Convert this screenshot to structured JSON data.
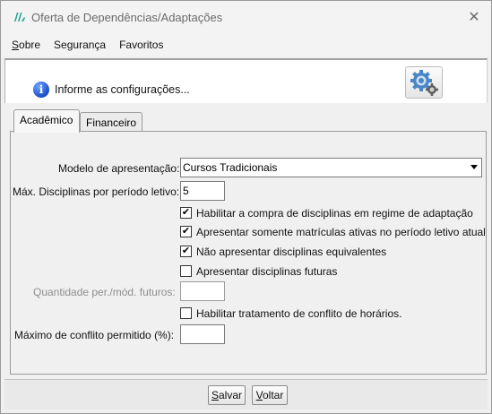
{
  "window": {
    "title": "Oferta de Dependências/Adaptações",
    "close_glyph": "✕"
  },
  "menu": [
    {
      "label": "Sobre",
      "accel": "S",
      "rest": "obre"
    },
    {
      "label": "Segurança"
    },
    {
      "label": "Favoritos"
    }
  ],
  "header": {
    "info_glyph": "i",
    "message": "Informe as configurações...",
    "config_icon": "gear-icon"
  },
  "tabs": [
    {
      "label": "Acadêmico",
      "selected": true
    },
    {
      "label": "Financeiro",
      "selected": false
    }
  ],
  "form": {
    "modelo_label": "Modelo de apresentação:",
    "modelo_value": "Cursos Tradicionais",
    "max_disc_label": "Máx. Disciplinas por período letivo:",
    "max_disc_value": "5",
    "chk_compra": {
      "label": "Habilitar a compra de disciplinas em regime de adaptação",
      "checked": true
    },
    "chk_ativas": {
      "label": "Apresentar somente matrículas ativas no período letivo atual",
      "checked": true
    },
    "chk_equivalentes": {
      "label": "Não apresentar disciplinas equivalentes",
      "checked": true
    },
    "chk_futuras": {
      "label": "Apresentar disciplinas futuras",
      "checked": false
    },
    "qtd_futuros_label": "Quantidade per./mód. futuros:",
    "qtd_futuros_value": "",
    "chk_conflito": {
      "label": "Habilitar tratamento de conflito de horários.",
      "checked": false
    },
    "max_conflito_label": "Máximo de conflito permitido (%):",
    "max_conflito_value": "",
    "check_glyph": "✔"
  },
  "buttons": {
    "save": {
      "label": "Salvar",
      "accel": "S",
      "rest": "alvar"
    },
    "back": {
      "label": "Voltar",
      "accel": "V",
      "rest": "oltar"
    }
  },
  "colors": {
    "info_blue": "#1a4ec9",
    "panel_white": "#ffffff",
    "window_bg": "#f0f0f0"
  }
}
